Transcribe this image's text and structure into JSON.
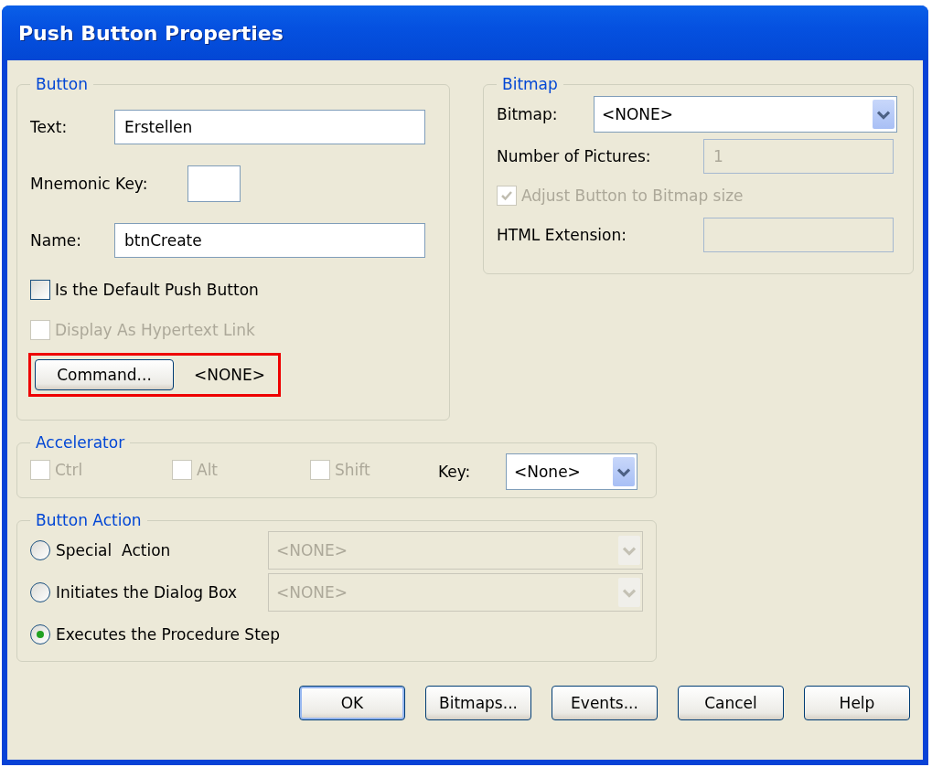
{
  "window": {
    "title": "Push Button Properties"
  },
  "button_group": {
    "title": "Button",
    "text_label": "Text:",
    "text_value": "Erstellen",
    "mnemonic_label": "Mnemonic Key:",
    "name_label": "Name:",
    "name_value": "btnCreate",
    "checkboxes": [
      {
        "label": "Is the Default Push Button",
        "checked": false,
        "disabled": false
      },
      {
        "label": "Display As Hypertext Link",
        "checked": false,
        "disabled": true
      }
    ],
    "command_button": "Command...",
    "command_value": "<NONE>",
    "highlighted": true
  },
  "bitmap_group": {
    "title": "Bitmap",
    "bitmap_label": "Bitmap:",
    "bitmap_value": "<NONE>",
    "pictures_label": "Number of Pictures:",
    "pictures_value": "1",
    "adjust": {
      "label": "Adjust Button to Bitmap size",
      "checked": true,
      "disabled": true
    },
    "html_label": "HTML Extension:"
  },
  "accelerator": {
    "title": "Accelerator",
    "modifiers": [
      {
        "label": "Ctrl",
        "checked": false,
        "disabled": true
      },
      {
        "label": "Alt",
        "checked": false,
        "disabled": true
      },
      {
        "label": "Shift",
        "checked": false,
        "disabled": true
      }
    ],
    "key_label": "Key:",
    "key_value": "<None>"
  },
  "button_action": {
    "title": "Button Action",
    "options": [
      {
        "label": "Special  Action",
        "selected": false,
        "dropdown": {
          "value": "<NONE>",
          "disabled": true
        }
      },
      {
        "label": "Initiates the Dialog Box",
        "selected": false,
        "dropdown": {
          "value": "<NONE>",
          "disabled": true
        }
      },
      {
        "label": "Executes the Procedure Step",
        "selected": true
      }
    ]
  },
  "buttons": [
    {
      "label": "OK",
      "default": true
    },
    {
      "label": "Bitmaps...",
      "default": false
    },
    {
      "label": "Events...",
      "default": false
    },
    {
      "label": "Cancel",
      "default": false
    },
    {
      "label": "Help",
      "default": false
    }
  ]
}
